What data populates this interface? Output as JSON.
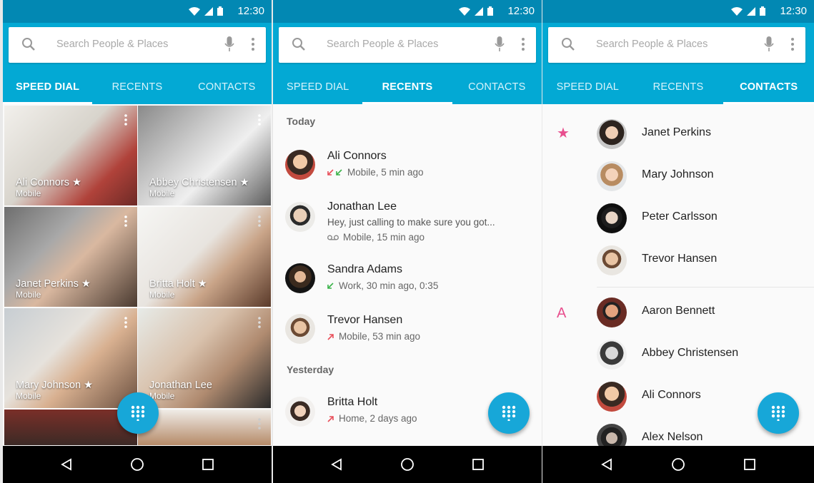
{
  "status": {
    "time": "12:30"
  },
  "search": {
    "placeholder": "Search People  & Places"
  },
  "tabs": [
    "SPEED DIAL",
    "RECENTS",
    "CONTACTS"
  ],
  "speed_dial": [
    {
      "name": "Ali Connors ★",
      "type": "Mobile"
    },
    {
      "name": "Abbey Christensen ★",
      "type": "Mobile"
    },
    {
      "name": "Janet Perkins ★",
      "type": "Mobile"
    },
    {
      "name": "Britta Holt ★",
      "type": "Mobile"
    },
    {
      "name": "Mary Johnson ★",
      "type": "Mobile"
    },
    {
      "name": "Jonathan Lee",
      "type": "Mobile"
    }
  ],
  "recents": {
    "today_label": "Today",
    "yesterday_label": "Yesterday",
    "items": [
      {
        "name": "Ali Connors",
        "detail": "Mobile, 5 min ago"
      },
      {
        "name": "Jonathan Lee",
        "message": "Hey, just calling to make sure you got...",
        "detail": "Mobile, 15 min ago"
      },
      {
        "name": "Sandra Adams",
        "detail": "Work, 30 min ago, 0:35"
      },
      {
        "name": "Trevor Hansen",
        "detail": "Mobile, 53 min ago"
      },
      {
        "name": "Britta Holt",
        "detail": "Home, 2 days ago"
      }
    ]
  },
  "contacts": {
    "starred_symbol": "★",
    "letter_a": "A",
    "items": [
      "Janet Perkins",
      "Mary Johnson",
      "Peter Carlsson",
      "Trevor Hansen",
      "Aaron Bennett",
      "Abbey Christensen",
      "Ali Connors",
      "Alex Nelson"
    ]
  },
  "colors": {
    "status": "#0288b3",
    "appbar": "#03a9d4",
    "fab": "#17a7d8",
    "accent_pink": "#e84f8e"
  }
}
